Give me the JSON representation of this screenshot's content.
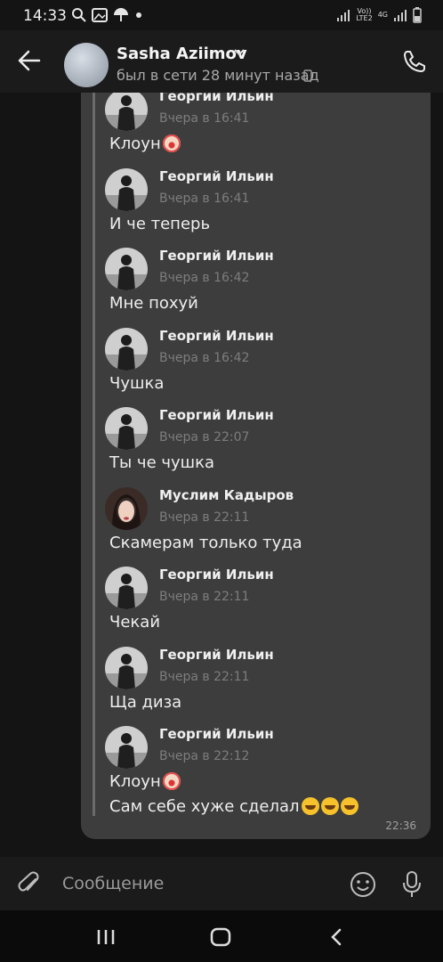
{
  "status_bar": {
    "time": "14:33",
    "network_top": "Vo))",
    "network_bottom": "LTE2",
    "net_type": "4G",
    "icons": [
      "search-icon",
      "gallery-icon",
      "umbrella-icon",
      "dot-icon",
      "signal-icon",
      "battery-icon"
    ]
  },
  "header": {
    "contact_name": "Sasha Aziimov",
    "status": "был в сети 28 минут назад"
  },
  "messages": [
    {
      "author": "Георгий Ильин",
      "time": "Вчера в 16:41",
      "text": "Клоун",
      "emoji": "clown"
    },
    {
      "author": "Георгий Ильин",
      "time": "Вчера в 16:41",
      "text": "И че теперь"
    },
    {
      "author": "Георгий Ильин",
      "time": "Вчера в 16:42",
      "text": "Мне похуй"
    },
    {
      "author": "Георгий Ильин",
      "time": "Вчера в 16:42",
      "text": "Чушка"
    },
    {
      "author": "Георгий Ильин",
      "time": "Вчера в 22:07",
      "text": "Ты че чушка"
    },
    {
      "author": "Муслим Кадыров",
      "time": "Вчера в 22:11",
      "text": "Скамерам только туда"
    },
    {
      "author": "Георгий Ильин",
      "time": "Вчера в 22:11",
      "text": "Чекай"
    },
    {
      "author": "Георгий Ильин",
      "time": "Вчера в 22:11",
      "text": "Ща диза"
    },
    {
      "author": "Георгий Ильин",
      "time": "Вчера в 22:12",
      "text": "Клоун",
      "emoji": "clown",
      "text2": "Сам себе хуже сделал"
    }
  ],
  "bubble_time": "22:36",
  "input": {
    "placeholder": "Сообщение"
  },
  "colors": {
    "background": "#141414",
    "bubble": "#3d3d3d",
    "header": "#1b1b1b"
  }
}
